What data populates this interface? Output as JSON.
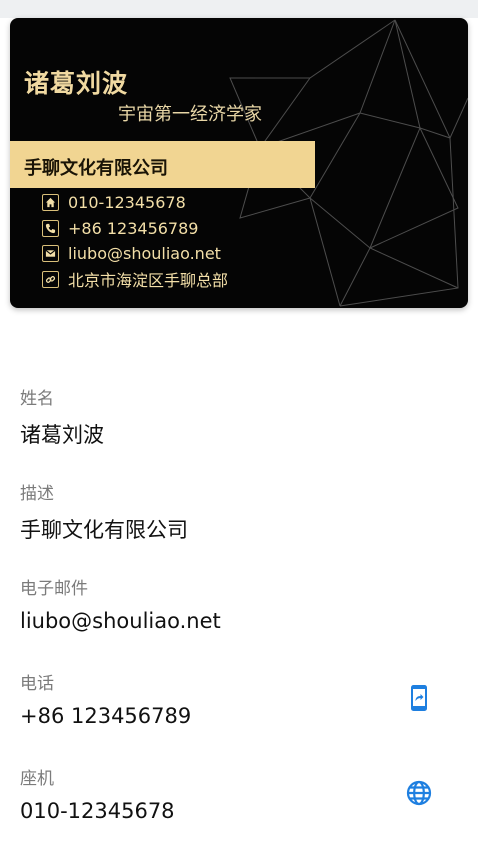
{
  "card": {
    "name": "诸葛刘波",
    "title": "宇宙第一经济学家",
    "company": "手聊文化有限公司",
    "info": [
      {
        "icon": "home-icon",
        "text": "010-12345678"
      },
      {
        "icon": "phone-icon",
        "text": "+86 123456789"
      },
      {
        "icon": "mail-icon",
        "text": "liubo@shouliao.net"
      },
      {
        "icon": "link-icon",
        "text": "北京市海淀区手聊总部"
      }
    ],
    "colors": {
      "background": "#050505",
      "gold": "#f1d592",
      "text_gold": "#f0d9a1"
    }
  },
  "fields": {
    "name": {
      "label": "姓名",
      "value": "诸葛刘波"
    },
    "description": {
      "label": "描述",
      "value": "手聊文化有限公司"
    },
    "email": {
      "label": "电子邮件",
      "value": "liubo@shouliao.net"
    },
    "phone": {
      "label": "电话",
      "value": "+86 123456789",
      "action_icon": "mobile-share-icon"
    },
    "landline": {
      "label": "座机",
      "value": "010-12345678",
      "action_icon": "globe-icon"
    }
  },
  "accent_color": "#1e7fe0"
}
